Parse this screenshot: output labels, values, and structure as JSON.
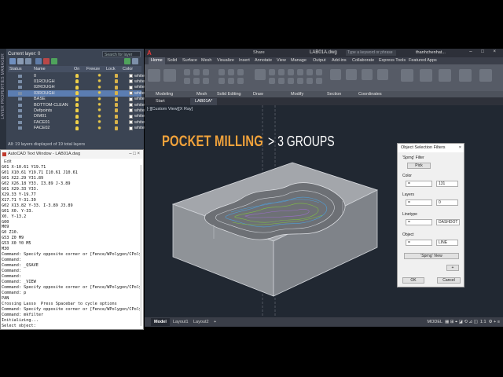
{
  "layers_panel": {
    "side_label": "LAYER PROPERTIES MANAGER",
    "current_layer": "Current layer: 0",
    "search_placeholder": "Search for layer",
    "headers": {
      "status": "Status",
      "name": "Name",
      "on": "On",
      "freeze": "Freeze",
      "lock": "Lock",
      "color": "Color"
    },
    "rows": [
      {
        "name": "0",
        "color_name": "white",
        "swatch": "#ffffff",
        "selected": false
      },
      {
        "name": "01ROUGH",
        "color_name": "white",
        "swatch": "#ffffff",
        "selected": false
      },
      {
        "name": "02ROUGH",
        "color_name": "white",
        "swatch": "#ffffff",
        "selected": false
      },
      {
        "name": "03ROUGH",
        "color_name": "white",
        "swatch": "#ffffff",
        "selected": true
      },
      {
        "name": "BASE",
        "color_name": "white",
        "swatch": "#ffffff",
        "selected": false
      },
      {
        "name": "BOTTOM-CLEAN",
        "color_name": "white",
        "swatch": "#ffffff",
        "selected": false
      },
      {
        "name": "Defpoints",
        "color_name": "white",
        "swatch": "#ffffff",
        "selected": false
      },
      {
        "name": "DIM01",
        "color_name": "white",
        "swatch": "#ffffff",
        "selected": false
      },
      {
        "name": "FACE01",
        "color_name": "white",
        "swatch": "#ffffff",
        "selected": false
      },
      {
        "name": "FACE02",
        "color_name": "white",
        "swatch": "#ffffff",
        "selected": false
      }
    ],
    "status_text": "All: 19 layers displayed of 19 total layers"
  },
  "text_window": {
    "title": "AutoCAD Text Window - LAB01A.dwg",
    "menu": "Edit",
    "lines": [
      "G01 X-10.61 Y19.71",
      "G01 X10.61 Y19.71 I10.61 J10.61",
      "G01 X22.29 Y31.89",
      "G02 X26.18 Y33. I3.89 J-3.89",
      "G01 X29.33 Y33.",
      "X29.33 Y-19.77",
      "X17.71 Y-31.39",
      "G02 X13.82 Y-33. I-3.89 J3.89",
      "G01 X0. Y-33.",
      "X0. Y-13.2",
      "G00",
      "M09",
      "G0 Z10.",
      "G53 Z0 M9",
      "G53 X0 Y0 M5",
      "M30",
      "Command: Specify opposite corner or [Fence/WPolygon/CPolyg",
      "Command:",
      "Command: _QSAVE",
      "Command:",
      "Command:",
      "Command: _VIEW",
      "Command: Specify opposite corner or [Fence/WPolygon/CPolyg",
      "Command: p",
      "PAN",
      "Crossing Lasso  Press Spacebar to cycle options",
      "Command: Specify opposite corner or [Fence/WPolygon/CPolyg",
      "Command: mkfilter",
      "",
      "Initializing...",
      "Select object:"
    ]
  },
  "title_bar": {
    "logo": "A",
    "share": "Share",
    "filename": "LAB01A.dwg",
    "search_placeholder": "Type a keyword or phrase",
    "user": "thanhchenhat...",
    "window_controls": "– □ ×"
  },
  "ribbon_tabs": [
    "Home",
    "Solid",
    "Surface",
    "Mesh",
    "Visualize",
    "Insert",
    "Annotate",
    "View",
    "Manage",
    "Output",
    "Add-ins",
    "Collaborate",
    "Express Tools",
    "Featured Apps"
  ],
  "ribbon_panels": [
    "Modeling",
    "Mesh",
    "Solid Editing",
    "Draw",
    "Modify",
    "Section",
    "Coordinates"
  ],
  "doc_tabs": [
    "Start",
    "LAB01A*"
  ],
  "viewport": {
    "label": "[-][Custom View][X Ray]",
    "overlay_title": "POCKET MILLING",
    "overlay_subtitle": "> 3 GROUPS"
  },
  "dialog": {
    "title": "Object Selection Filters",
    "close": "×",
    "sprng_filter_label": "'Sprng' Filter",
    "pick": "Pick",
    "color_label": "Color",
    "color_op": "=",
    "color_value": "131",
    "layers_label": "Layers",
    "layers_op": "=",
    "layers_value": "0",
    "linetype_label": "Linetype",
    "linetype_op": "=",
    "linetype_value": "DASHDOT",
    "object_label": "Object",
    "object_op": "=",
    "object_value": "LINE",
    "sprng_view": "'Sprng' View",
    "small_btn": "+",
    "ok": "OK",
    "cancel": "Cancel"
  },
  "layout_tabs": [
    "Model",
    "Layout1",
    "Layout2",
    "+"
  ],
  "status_bar": {
    "model": "MODEL",
    "scale": "1:1"
  }
}
